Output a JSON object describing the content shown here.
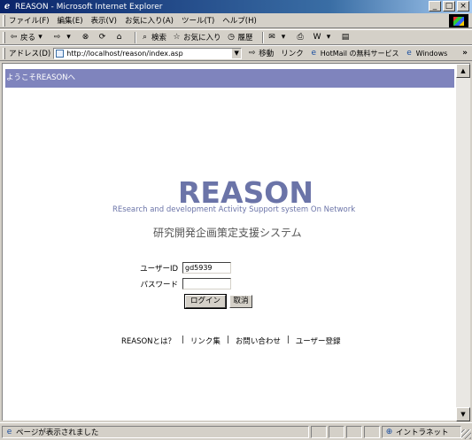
{
  "window": {
    "title": "REASON - Microsoft Internet Explorer",
    "controls": {
      "minimize": "_",
      "maximize": "□",
      "close": "×"
    }
  },
  "menu": {
    "items": [
      {
        "label": "ファイル(F)"
      },
      {
        "label": "編集(E)"
      },
      {
        "label": "表示(V)"
      },
      {
        "label": "お気に入り(A)"
      },
      {
        "label": "ツール(T)"
      },
      {
        "label": "ヘルプ(H)"
      }
    ]
  },
  "toolbar": {
    "back_label": "戻る",
    "search_label": "検索",
    "favorites_label": "お気に入り",
    "history_label": "履歴"
  },
  "address": {
    "label": "アドレス(D)",
    "url": "http://localhost/reason/index.asp",
    "go_label": "移動",
    "links_label": "リンク",
    "links": [
      {
        "label": "HotMail の無料サービス"
      },
      {
        "label": "Windows"
      }
    ],
    "more": "»"
  },
  "page": {
    "header": "ようこそREASONへ",
    "logo": "REASON",
    "tagline": "REsearch and development Activity Support system On Network",
    "subtitle": "研究開発企画策定支援システム",
    "login": {
      "user_label": "ユーザーID",
      "user_value": "gd5939",
      "password_label": "パスワード",
      "password_value": "",
      "login_button": "ログイン",
      "cancel_button": "取消"
    },
    "footer_links": [
      {
        "label": "REASONとは？"
      },
      {
        "label": "リンク集"
      },
      {
        "label": "お問い合わせ"
      },
      {
        "label": "ユーザー登録"
      }
    ],
    "separator": "|"
  },
  "status": {
    "text": "ページが表示されました",
    "zone": "イントラネット"
  }
}
